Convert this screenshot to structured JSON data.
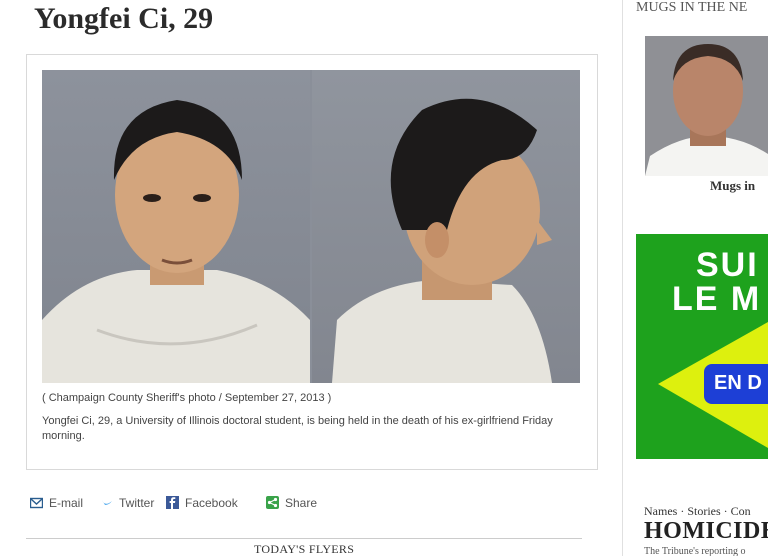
{
  "article": {
    "title": "Yongfei Ci, 29",
    "photo_credit": "( Champaign County Sheriff's photo / September 27, 2013 )",
    "caption": "Yongfei Ci, 29, a University of Illinois doctoral student, is being held in the death of his ex-girlfriend Friday morning."
  },
  "share": {
    "email": "E-mail",
    "twitter": "Twitter",
    "facebook": "Facebook",
    "share": "Share",
    "colors": {
      "email": "#2a5d8f",
      "twitter": "#55acee",
      "facebook": "#3b5998",
      "share": "#3aa34a"
    }
  },
  "footer": {
    "flyers": "TODAY'S FLYERS"
  },
  "sidebar": {
    "mugs_title": "MUGS IN THE NE",
    "mugs_caption": "Mugs in",
    "ad": {
      "line1": "SUI",
      "line2": "LE M",
      "button": "EN D",
      "bg": "#1ea21d",
      "accent": "#ddf00e"
    },
    "homicides": {
      "nav": "Names · Stories · Con",
      "title": "HOMICIDES",
      "sub": "The Tribune's reporting o"
    }
  }
}
